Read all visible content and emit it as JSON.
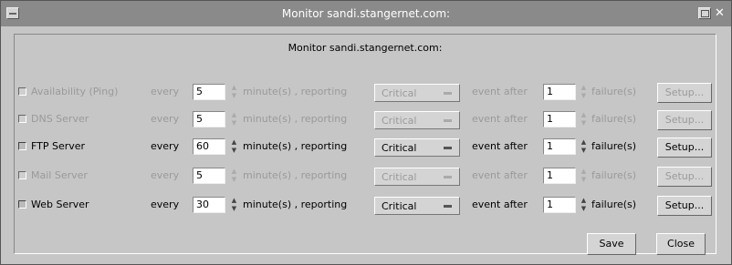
{
  "window": {
    "title": "Monitor sandi.stangernet.com:"
  },
  "dialog": {
    "header": "Monitor sandi.stangernet.com:"
  },
  "labels": {
    "every": "every",
    "minutes_reporting": "minute(s) , reporting",
    "event_after": "event after",
    "failures": "failure(s)",
    "setup": "Setup..."
  },
  "services": [
    {
      "name": "Availability (Ping)",
      "checked": false,
      "interval": "5",
      "severity": "Critical",
      "failures": "1"
    },
    {
      "name": "DNS Server",
      "checked": false,
      "interval": "5",
      "severity": "Critical",
      "failures": "1"
    },
    {
      "name": "FTP Server",
      "checked": true,
      "interval": "60",
      "severity": "Critical",
      "failures": "1"
    },
    {
      "name": "Mail Server",
      "checked": false,
      "interval": "5",
      "severity": "Critical",
      "failures": "1"
    },
    {
      "name": "Web Server",
      "checked": true,
      "interval": "30",
      "severity": "Critical",
      "failures": "1"
    }
  ],
  "buttons": {
    "save": "Save",
    "close": "Close"
  },
  "icons": {
    "menu": "window-menu-icon",
    "maximize": "maximize-icon",
    "close": "close-icon",
    "spin_up": "spin-up-icon",
    "spin_down": "spin-down-icon",
    "dropdown": "dropdown-indicator-icon"
  }
}
